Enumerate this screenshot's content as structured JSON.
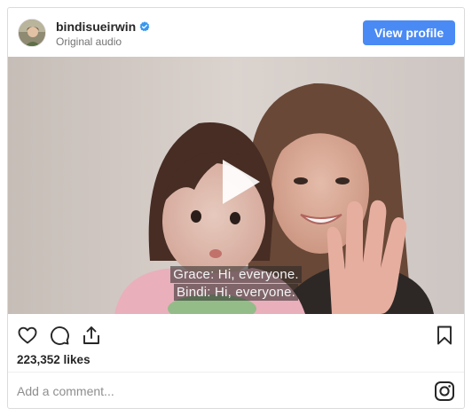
{
  "post": {
    "username": "bindisueirwin",
    "subtitle": "Original audio",
    "verified": true,
    "view_profile_label": "View profile"
  },
  "media": {
    "type": "video",
    "captions": [
      "Grace: Hi, everyone.",
      "Bindi: Hi, everyone."
    ]
  },
  "actions": {
    "icons": [
      "heart-icon",
      "comment-icon",
      "share-icon",
      "bookmark-icon"
    ]
  },
  "likes": "223,352 likes",
  "comment": {
    "placeholder": "Add a comment..."
  },
  "footer": {
    "icon": "instagram-icon"
  },
  "colors": {
    "accent": "#4a8af4",
    "verified": "#3897f0",
    "text": "#262626",
    "muted": "#737373"
  }
}
